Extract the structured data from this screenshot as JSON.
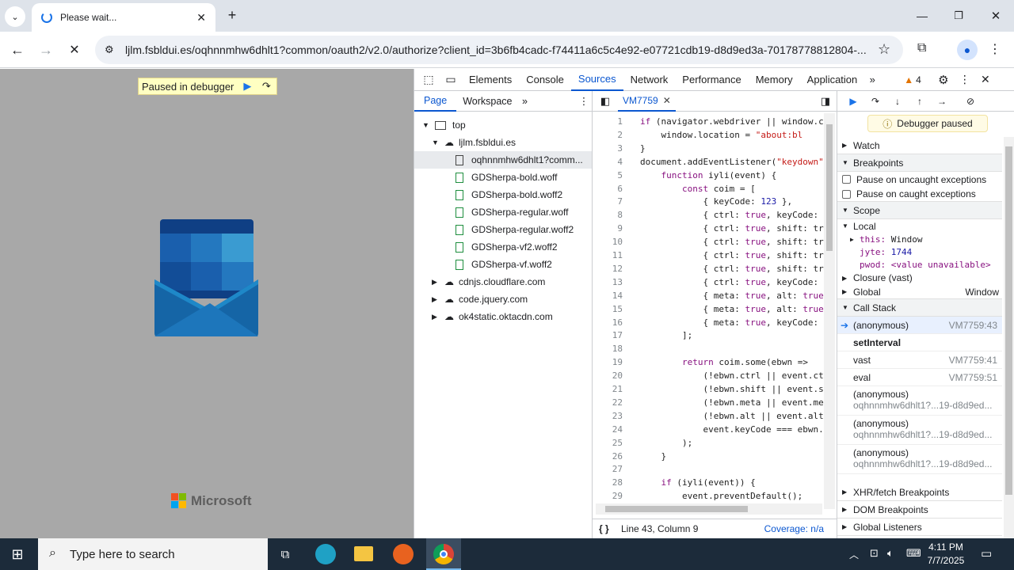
{
  "browser": {
    "tab_title": "Please wait...",
    "url": "ljlm.fsbldui.es/oqhnnmhw6dhlt1?common/oauth2/v2.0/authorize?client_id=3b6fb4cadc-f74411a6c5c4e92-e07721cdb19-d8d9ed3a-70178778812804-..."
  },
  "page": {
    "paused_label": "Paused in debugger",
    "brand": "Microsoft"
  },
  "devtools": {
    "tabs": [
      "Elements",
      "Console",
      "Sources",
      "Network",
      "Performance",
      "Memory",
      "Application"
    ],
    "warnings": "4",
    "nav_tabs": {
      "page": "Page",
      "workspace": "Workspace"
    },
    "tree": {
      "top": "top",
      "host": "ljlm.fsbldui.es",
      "files": [
        "oqhnnmhw6dhlt1?comm...",
        "GDSherpa-bold.woff",
        "GDSherpa-bold.woff2",
        "GDSherpa-regular.woff",
        "GDSherpa-regular.woff2",
        "GDSherpa-vf2.woff2",
        "GDSherpa-vf.woff2"
      ],
      "hosts": [
        "cdnjs.cloudflare.com",
        "code.jquery.com",
        "ok4static.oktacdn.com"
      ]
    },
    "editor_tab": "VM7759",
    "code_lines": [
      "if (navigator.webdriver || window.c",
      "    window.location = \"about:bl",
      "}",
      "document.addEventListener(\"keydown\"",
      "    function iyli(event) {",
      "        const coim = [",
      "            { keyCode: 123 },",
      "            { ctrl: true, keyCode:",
      "            { ctrl: true, shift: tr",
      "            { ctrl: true, shift: tr",
      "            { ctrl: true, shift: tr",
      "            { ctrl: true, shift: tr",
      "            { ctrl: true, keyCode:",
      "            { meta: true, alt: true",
      "            { meta: true, alt: true",
      "            { meta: true, keyCode:",
      "        ];",
      "",
      "        return coim.some(ebwn =>",
      "            (!ebwn.ctrl || event.ct",
      "            (!ebwn.shift || event.s",
      "            (!ebwn.meta || event.me",
      "            (!ebwn.alt || event.alt",
      "            event.keyCode === ebwn.",
      "        );",
      "    }",
      "",
      "    if (iyli(event)) {",
      "        event.preventDefault();"
    ],
    "status": {
      "position": "Line 43, Column 9",
      "coverage": "Coverage: n/a"
    },
    "debugger": {
      "paused": "Debugger paused",
      "watch": "Watch",
      "breakpoints": "Breakpoints",
      "uncaught": "Pause on uncaught exceptions",
      "caught": "Pause on caught exceptions",
      "scope": "Scope",
      "local": "Local",
      "this_key": "this:",
      "this_val": "Window",
      "jyte_key": "jyte:",
      "jyte_val": "1744",
      "pwod_key": "pwod:",
      "pwod_val": "<value unavailable>",
      "closure": "Closure (vast)",
      "global": "Global",
      "global_val": "Window",
      "callstack": "Call Stack",
      "frames": [
        {
          "name": "(anonymous)",
          "loc": "VM7759:43"
        },
        {
          "name": "setInterval",
          "loc": ""
        },
        {
          "name": "vast",
          "loc": "VM7759:41"
        },
        {
          "name": "eval",
          "loc": "VM7759:51"
        },
        {
          "name": "(anonymous)",
          "loc": "oqhnnmhw6dhlt1?...19-d8d9ed..."
        },
        {
          "name": "(anonymous)",
          "loc": "oqhnnmhw6dhlt1?...19-d8d9ed..."
        },
        {
          "name": "(anonymous)",
          "loc": "oqhnnmhw6dhlt1?...19-d8d9ed..."
        }
      ],
      "xhr": "XHR/fetch Breakpoints",
      "dom": "DOM Breakpoints",
      "listeners": "Global Listeners"
    }
  },
  "taskbar": {
    "search": "Type here to search",
    "time": "4:11 PM",
    "date": "7/7/2025"
  }
}
